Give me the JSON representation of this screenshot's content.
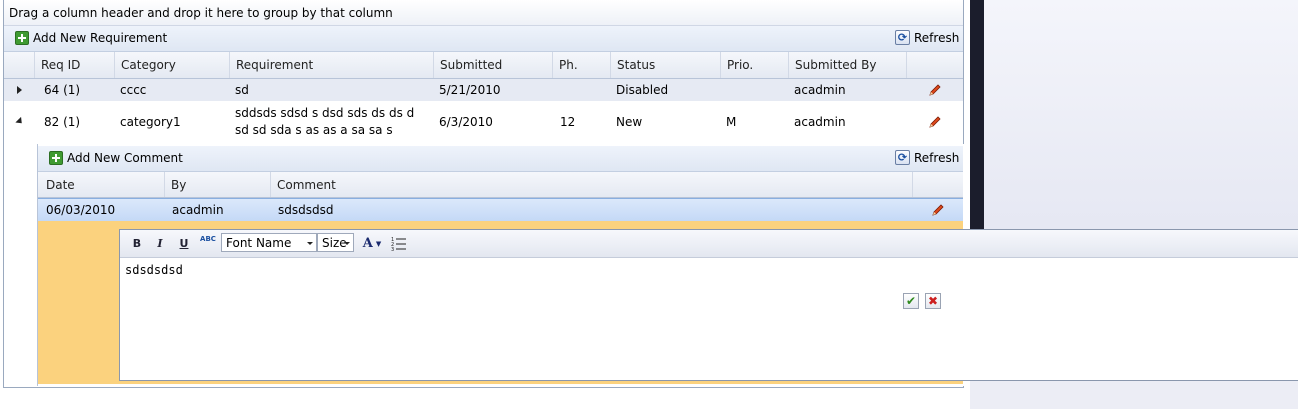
{
  "group_panel": {
    "hint": "Drag a column header and drop it here to group by that column"
  },
  "requirements": {
    "add_label": "Add New Requirement",
    "refresh_label": "Refresh",
    "columns": [
      "Req ID",
      "Category",
      "Requirement",
      "Submitted",
      "Ph.",
      "Status",
      "Prio.",
      "Submitted By"
    ],
    "rows": [
      {
        "id": "64 (1)",
        "category": "cccc",
        "requirement": "sd",
        "submitted": "5/21/2010",
        "phase": "",
        "status": "Disabled",
        "priority": "",
        "submitted_by": "acadmin",
        "expanded": false
      },
      {
        "id": "82 (1)",
        "category": "category1",
        "requirement_line1": "sddsds sdsd s dsd sds ds ds d",
        "requirement_line2": "sd sd sda s as as a sa sa s",
        "submitted": "6/3/2010",
        "phase": "12",
        "status": "New",
        "priority": "M",
        "submitted_by": "acadmin",
        "expanded": true
      }
    ]
  },
  "comments": {
    "add_label": "Add New Comment",
    "refresh_label": "Refresh",
    "columns": [
      "Date",
      "By",
      "Comment"
    ],
    "rows": [
      {
        "date": "06/03/2010",
        "by": "acadmin",
        "comment": "sdsdsdsd"
      }
    ]
  },
  "editor": {
    "toolbar": {
      "bold": "B",
      "italic": "I",
      "underline": "U",
      "spellcheck": "ABC",
      "font_name": "Font Name",
      "font_size": "Size",
      "font_color": "A"
    },
    "content": "sdsdsdsd",
    "ok_symbol": "✔",
    "cancel_symbol": "✖"
  },
  "colors": {
    "edit_area": "#fbd27e",
    "selected_row": "#c4d9f6",
    "right_divider": "#1b1d2c"
  }
}
